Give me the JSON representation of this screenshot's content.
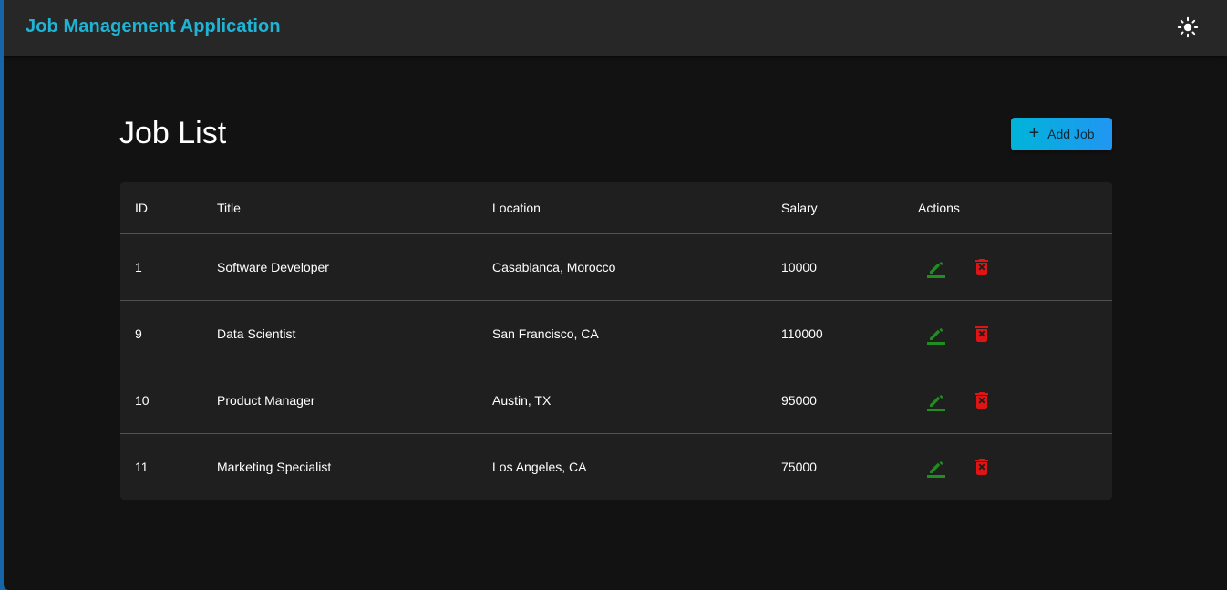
{
  "app": {
    "title": "Job Management Application",
    "accent_color": "#1fb4d6",
    "theme_toggle_icon": "sun-icon"
  },
  "page": {
    "title": "Job List",
    "add_button_label": "Add Job",
    "add_button_icon": "plus-icon"
  },
  "table": {
    "headers": {
      "id": "ID",
      "title": "Title",
      "location": "Location",
      "salary": "Salary",
      "actions": "Actions"
    },
    "rows": [
      {
        "id": "1",
        "title": "Software Developer",
        "location": "Casablanca, Morocco",
        "salary": "10000"
      },
      {
        "id": "9",
        "title": "Data Scientist",
        "location": "San Francisco, CA",
        "salary": "110000"
      },
      {
        "id": "10",
        "title": "Product Manager",
        "location": "Austin, TX",
        "salary": "95000"
      },
      {
        "id": "11",
        "title": "Marketing Specialist",
        "location": "Los Angeles, CA",
        "salary": "75000"
      }
    ],
    "edit_icon": "pencil-icon",
    "delete_icon": "trash-icon",
    "edit_color": "#1e8e1e",
    "delete_color": "#e01414"
  }
}
